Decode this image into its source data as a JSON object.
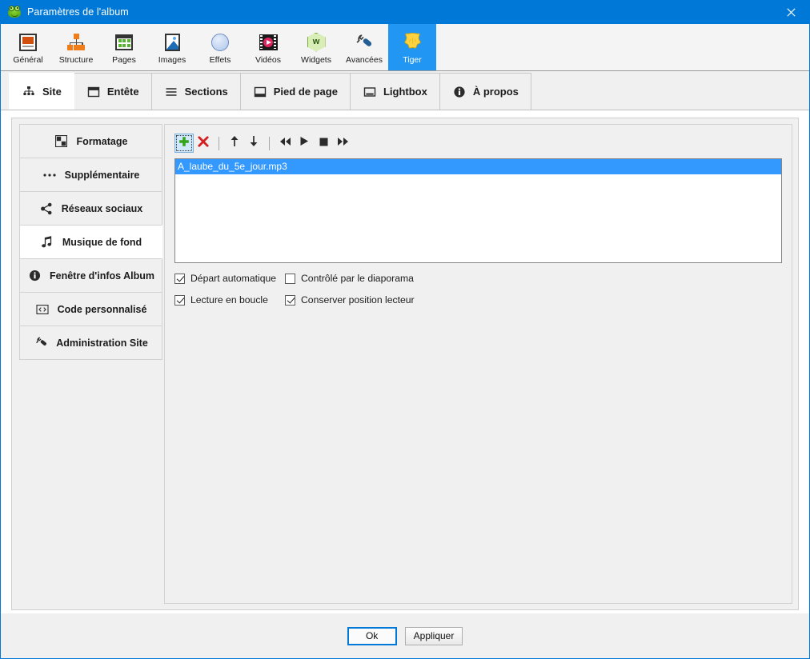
{
  "window": {
    "title": "Paramètres de l'album",
    "app_icon": "frog-icon",
    "close_label": "✕",
    "accent_color": "#0078d7",
    "selection_color": "#3399ff"
  },
  "toolbar": {
    "items": [
      {
        "label": "Général",
        "icon": "general-icon",
        "selected": false
      },
      {
        "label": "Structure",
        "icon": "structure-icon",
        "selected": false
      },
      {
        "label": "Pages",
        "icon": "pages-icon",
        "selected": false
      },
      {
        "label": "Images",
        "icon": "images-icon",
        "selected": false
      },
      {
        "label": "Effets",
        "icon": "effects-icon",
        "selected": false
      },
      {
        "label": "Vidéos",
        "icon": "videos-icon",
        "selected": false
      },
      {
        "label": "Widgets",
        "icon": "widgets-icon",
        "selected": false
      },
      {
        "label": "Avancées",
        "icon": "wrench-icon",
        "selected": false
      },
      {
        "label": "Tiger",
        "icon": "tiger-icon",
        "selected": true
      }
    ]
  },
  "tabs": [
    {
      "label": "Site",
      "icon": "sitemap-icon",
      "active": true
    },
    {
      "label": "Entête",
      "icon": "header-icon",
      "active": false
    },
    {
      "label": "Sections",
      "icon": "hamburger-icon",
      "active": false
    },
    {
      "label": "Pied de page",
      "icon": "footer-icon",
      "active": false
    },
    {
      "label": "Lightbox",
      "icon": "lightbox-icon",
      "active": false
    },
    {
      "label": "À propos",
      "icon": "info-icon",
      "active": false
    }
  ],
  "sidebar": {
    "items": [
      {
        "label": "Formatage",
        "icon": "format-icon",
        "active": false
      },
      {
        "label": "Supplémentaire",
        "icon": "ellipsis-icon",
        "active": false
      },
      {
        "label": "Réseaux sociaux",
        "icon": "share-icon",
        "active": false
      },
      {
        "label": "Musique de fond",
        "icon": "music-note-icon",
        "active": true
      },
      {
        "label": "Fenêtre d'infos Album",
        "icon": "info-icon",
        "active": false
      },
      {
        "label": "Code personnalisé",
        "icon": "code-icon",
        "active": false
      },
      {
        "label": "Administration Site",
        "icon": "wrench-icon",
        "active": false
      }
    ]
  },
  "music_panel": {
    "toolbar_buttons": [
      {
        "name": "add-button",
        "icon": "plus-icon",
        "focused": true
      },
      {
        "name": "delete-button",
        "icon": "red-x-icon",
        "focused": false
      },
      {
        "name": "move-up-button",
        "icon": "arrow-up-icon",
        "focused": false
      },
      {
        "name": "move-down-button",
        "icon": "arrow-down-icon",
        "focused": false
      },
      {
        "name": "rewind-button",
        "icon": "rewind-icon",
        "focused": false
      },
      {
        "name": "play-button",
        "icon": "play-icon",
        "focused": false
      },
      {
        "name": "stop-button",
        "icon": "stop-icon",
        "focused": false
      },
      {
        "name": "fast-forward-button",
        "icon": "fast-forward-icon",
        "focused": false
      }
    ],
    "tracks": [
      {
        "name": "A_laube_du_5e_jour.mp3",
        "selected": true
      }
    ],
    "checkboxes": [
      {
        "label": "Départ automatique",
        "checked": true
      },
      {
        "label": "Contrôlé par le diaporama",
        "checked": false
      },
      {
        "label": "Lecture en boucle",
        "checked": true
      },
      {
        "label": "Conserver position lecteur",
        "checked": true
      }
    ]
  },
  "footer": {
    "ok_label": "Ok",
    "apply_label": "Appliquer"
  }
}
